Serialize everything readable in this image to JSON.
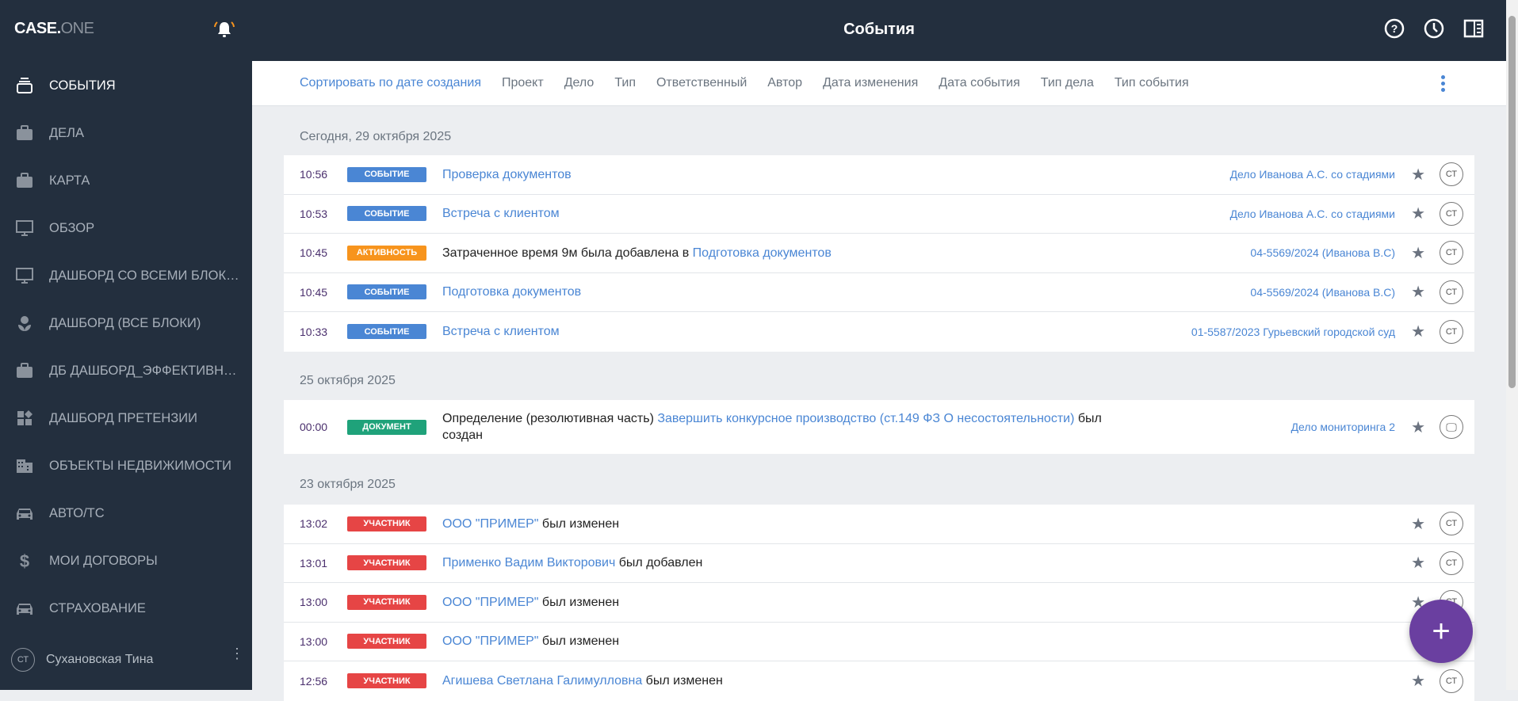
{
  "app": {
    "logo_main": "CASE.",
    "logo_sub": "ONE",
    "title": "События"
  },
  "colors": {
    "sidebar": "#232f3e",
    "accent": "#4a86d4",
    "event": "#4a86d4",
    "activity": "#f7941d",
    "document": "#1fa27a",
    "participant": "#e64545",
    "fab": "#6a3fa0"
  },
  "sidebar": {
    "items": [
      {
        "label": "События",
        "icon": "events-icon",
        "active": true
      },
      {
        "label": "Дела",
        "icon": "briefcase-icon"
      },
      {
        "label": "Карта",
        "icon": "briefcase-icon"
      },
      {
        "label": "Обзор",
        "icon": "monitor-icon"
      },
      {
        "label": "Дашборд со всеми блока...",
        "icon": "monitor-icon"
      },
      {
        "label": "Дашборд (все блоки)",
        "icon": "flower-icon"
      },
      {
        "label": "ДБ Дашборд_Эффективно...",
        "icon": "briefcase-icon"
      },
      {
        "label": "Дашборд претензии",
        "icon": "widgets-icon"
      },
      {
        "label": "Объекты недвижимости",
        "icon": "building-icon"
      },
      {
        "label": "Авто/ТС",
        "icon": "car-icon"
      },
      {
        "label": "Мои договоры",
        "icon": "dollar-icon"
      },
      {
        "label": "Страхование",
        "icon": "car-icon"
      }
    ],
    "user": {
      "initials": "СТ",
      "name": "Сухановская Тина"
    }
  },
  "filters": [
    "Сортировать по дате создания",
    "Проект",
    "Дело",
    "Тип",
    "Ответственный",
    "Автор",
    "Дата изменения",
    "Дата события",
    "Тип дела",
    "Тип события"
  ],
  "groups": [
    {
      "date": "Сегодня, 29 октября 2025",
      "rows": [
        {
          "time": "10:56",
          "badge": "СОБЫТИЕ",
          "type": "event",
          "pre": "",
          "link": "Проверка документов",
          "post": "",
          "case": "Дело Иванова А.С. со стадиями",
          "avatar": "СТ"
        },
        {
          "time": "10:53",
          "badge": "СОБЫТИЕ",
          "type": "event",
          "pre": "",
          "link": "Встреча с клиентом",
          "post": "",
          "case": "Дело Иванова А.С. со стадиями",
          "avatar": "СТ"
        },
        {
          "time": "10:45",
          "badge": "АКТИВНОСТЬ",
          "type": "activity",
          "pre": "Затраченное время 9м была добавлена в ",
          "link": "Подготовка документов",
          "post": "",
          "case": "04-5569/2024 (Иванова В.С)",
          "avatar": "СТ"
        },
        {
          "time": "10:45",
          "badge": "СОБЫТИЕ",
          "type": "event",
          "pre": "",
          "link": "Подготовка документов",
          "post": "",
          "case": "04-5569/2024 (Иванова В.С)",
          "avatar": "СТ"
        },
        {
          "time": "10:33",
          "badge": "СОБЫТИЕ",
          "type": "event",
          "pre": "",
          "link": "Встреча с клиентом",
          "post": "",
          "case": "01-5587/2023 Гурьевский городской суд",
          "avatar": "СТ"
        }
      ]
    },
    {
      "date": "25 октября 2025",
      "rows": [
        {
          "time": "00:00",
          "badge": "ДОКУМЕНТ",
          "type": "document",
          "pre": "Определение (резолютивная часть) ",
          "link": "Завершить конкурсное производство (ст.149 ФЗ О несостоятельности)",
          "post": " был создан",
          "case": "Дело мониторинга 2",
          "avatar": "monitor"
        }
      ]
    },
    {
      "date": "23 октября 2025",
      "rows": [
        {
          "time": "13:02",
          "badge": "УЧАСТНИК",
          "type": "participant",
          "pre": "",
          "link": "ООО \"ПРИМЕР\"",
          "post": " был изменен",
          "case": "",
          "avatar": "СТ"
        },
        {
          "time": "13:01",
          "badge": "УЧАСТНИК",
          "type": "participant",
          "pre": "",
          "link": "Применко Вадим Викторович",
          "post": " был добавлен",
          "case": "",
          "avatar": "СТ"
        },
        {
          "time": "13:00",
          "badge": "УЧАСТНИК",
          "type": "participant",
          "pre": "",
          "link": "ООО \"ПРИМЕР\"",
          "post": " был изменен",
          "case": "",
          "avatar": "СТ"
        },
        {
          "time": "13:00",
          "badge": "УЧАСТНИК",
          "type": "participant",
          "pre": "",
          "link": "ООО \"ПРИМЕР\"",
          "post": " был изменен",
          "case": "",
          "avatar": ""
        },
        {
          "time": "12:56",
          "badge": "УЧАСТНИК",
          "type": "participant",
          "pre": "",
          "link": "Агишева Светлана Галимулловна",
          "post": " был изменен",
          "case": "",
          "avatar": "СТ"
        }
      ]
    }
  ],
  "fab": {
    "label": "+"
  }
}
